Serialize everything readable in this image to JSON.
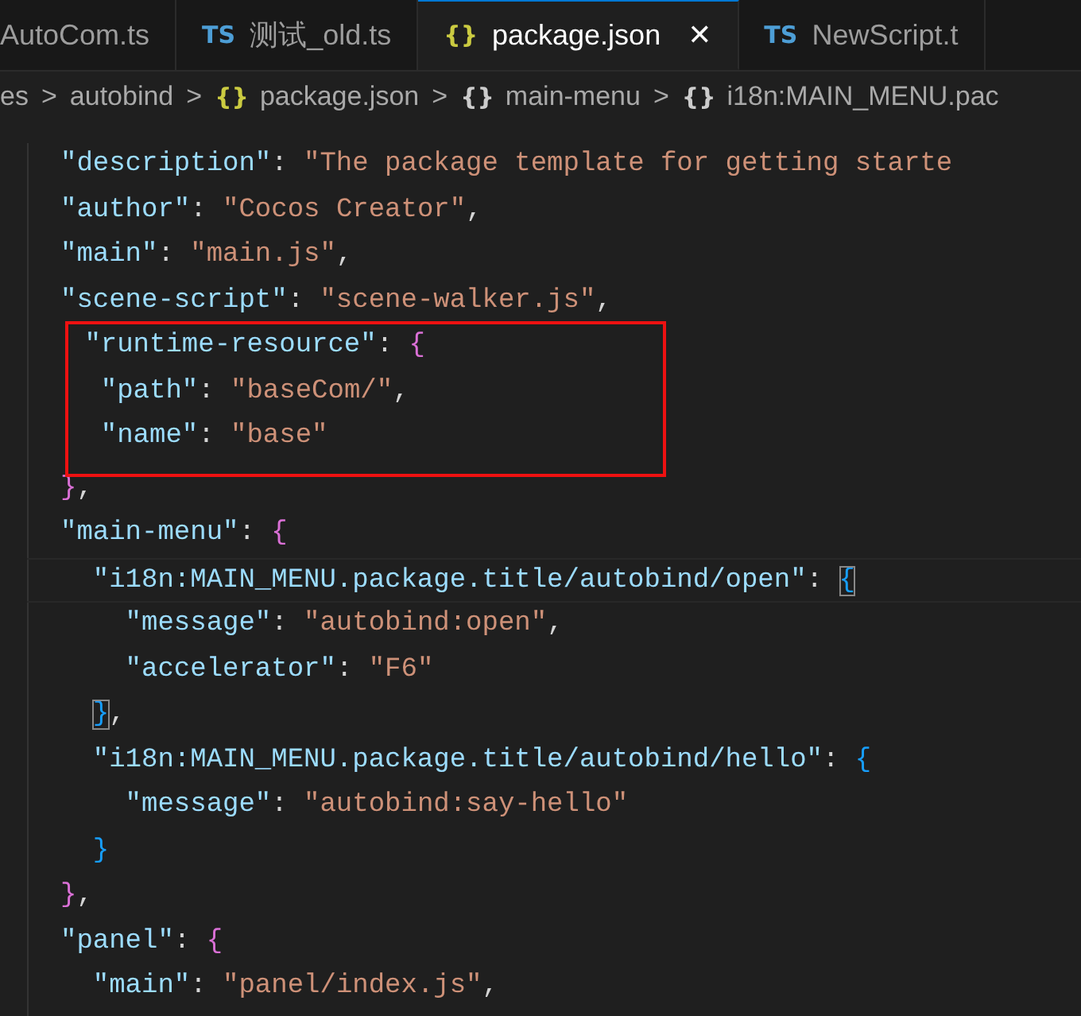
{
  "tabs": [
    {
      "label": "AutoCom.ts",
      "selected": false,
      "kind": "plain"
    },
    {
      "icon": "TS",
      "label": "测试_old.ts",
      "selected": false,
      "kind": "ts"
    },
    {
      "icon": "{}",
      "label": "package.json",
      "selected": true,
      "kind": "json",
      "close": "✕"
    },
    {
      "icon": "TS",
      "label": "NewScript.t",
      "selected": false,
      "kind": "ts"
    }
  ],
  "breadcrumbs": [
    {
      "label": "es",
      "kind": "plain"
    },
    {
      "label": "autobind",
      "kind": "plain"
    },
    {
      "icon": "{}",
      "label": "package.json",
      "kind": "json"
    },
    {
      "icon": "{}",
      "label": "main-menu",
      "kind": "symbol"
    },
    {
      "icon": "{}",
      "label": "i18n:MAIN_MENU.pac",
      "kind": "symbol"
    }
  ],
  "breadcrumb_separator": ">",
  "lines": [
    {
      "in_box": false,
      "current": false,
      "tokens": [
        {
          "kind": "key",
          "text": "\"description\""
        },
        {
          "kind": "punct",
          "text": ": "
        },
        {
          "kind": "string",
          "text": "\"The package template for getting starte"
        }
      ]
    },
    {
      "in_box": false,
      "current": false,
      "tokens": [
        {
          "kind": "key",
          "text": "\"author\""
        },
        {
          "kind": "punct",
          "text": ": "
        },
        {
          "kind": "string",
          "text": "\"Cocos Creator\""
        },
        {
          "kind": "punct",
          "text": ","
        }
      ]
    },
    {
      "in_box": false,
      "current": false,
      "tokens": [
        {
          "kind": "key",
          "text": "\"main\""
        },
        {
          "kind": "punct",
          "text": ": "
        },
        {
          "kind": "string",
          "text": "\"main.js\""
        },
        {
          "kind": "punct",
          "text": ","
        }
      ]
    },
    {
      "in_box": false,
      "current": false,
      "tokens": [
        {
          "kind": "key",
          "text": "\"scene-script\""
        },
        {
          "kind": "punct",
          "text": ": "
        },
        {
          "kind": "string",
          "text": "\"scene-walker.js\""
        },
        {
          "kind": "punct",
          "text": ","
        }
      ]
    },
    {
      "in_box": true,
      "current": false,
      "tokens": [
        {
          "kind": "key",
          "text": " \"runtime-resource\""
        },
        {
          "kind": "punct",
          "text": ": "
        },
        {
          "kind": "brace1",
          "text": "{"
        }
      ]
    },
    {
      "in_box": true,
      "current": false,
      "tokens": [
        {
          "kind": "key",
          "text": "  \"path\""
        },
        {
          "kind": "punct",
          "text": ": "
        },
        {
          "kind": "string",
          "text": "\"baseCom/\""
        },
        {
          "kind": "punct",
          "text": ","
        }
      ]
    },
    {
      "in_box": true,
      "current": false,
      "tokens": [
        {
          "kind": "key",
          "text": "  \"name\""
        },
        {
          "kind": "punct",
          "text": ": "
        },
        {
          "kind": "string",
          "text": "\"base\""
        }
      ]
    },
    {
      "in_box": false,
      "current": false,
      "tokens": [
        {
          "kind": "brace1",
          "text": "}"
        },
        {
          "kind": "punct",
          "text": ","
        }
      ]
    },
    {
      "in_box": false,
      "current": false,
      "tokens": [
        {
          "kind": "key",
          "text": "\"main-menu\""
        },
        {
          "kind": "punct",
          "text": ": "
        },
        {
          "kind": "brace1",
          "text": "{"
        }
      ]
    },
    {
      "in_box": false,
      "current": true,
      "tokens": [
        {
          "kind": "key",
          "text": "  \"i18n:MAIN_MENU.package.title/autobind/open\""
        },
        {
          "kind": "punct",
          "text": ": "
        },
        {
          "kind": "brace2_match",
          "text": "{"
        }
      ]
    },
    {
      "in_box": false,
      "current": false,
      "tokens": [
        {
          "kind": "key",
          "text": "    \"message\""
        },
        {
          "kind": "punct",
          "text": ": "
        },
        {
          "kind": "string",
          "text": "\"autobind:open\""
        },
        {
          "kind": "punct",
          "text": ","
        }
      ]
    },
    {
      "in_box": false,
      "current": false,
      "tokens": [
        {
          "kind": "key",
          "text": "    \"accelerator\""
        },
        {
          "kind": "punct",
          "text": ": "
        },
        {
          "kind": "string",
          "text": "\"F6\""
        }
      ]
    },
    {
      "in_box": false,
      "current": false,
      "tokens": [
        {
          "kind": "brace2_match",
          "text": "}"
        },
        {
          "kind": "punct",
          "text": ","
        }
      ],
      "nested": true
    },
    {
      "in_box": false,
      "current": false,
      "tokens": [
        {
          "kind": "key",
          "text": "  \"i18n:MAIN_MENU.package.title/autobind/hello\""
        },
        {
          "kind": "punct",
          "text": ": "
        },
        {
          "kind": "brace2",
          "text": "{"
        }
      ]
    },
    {
      "in_box": false,
      "current": false,
      "tokens": [
        {
          "kind": "key",
          "text": "    \"message\""
        },
        {
          "kind": "punct",
          "text": ": "
        },
        {
          "kind": "string",
          "text": "\"autobind:say-hello\""
        }
      ]
    },
    {
      "in_box": false,
      "current": false,
      "tokens": [
        {
          "kind": "brace2",
          "text": "}"
        }
      ],
      "nested": true
    },
    {
      "in_box": false,
      "current": false,
      "tokens": [
        {
          "kind": "brace1",
          "text": "}"
        },
        {
          "kind": "punct",
          "text": ","
        }
      ]
    },
    {
      "in_box": false,
      "current": false,
      "tokens": [
        {
          "kind": "key",
          "text": "\"panel\""
        },
        {
          "kind": "punct",
          "text": ": "
        },
        {
          "kind": "brace1",
          "text": "{"
        }
      ]
    },
    {
      "in_box": false,
      "current": false,
      "tokens": [
        {
          "kind": "key",
          "text": "  \"main\""
        },
        {
          "kind": "punct",
          "text": ": "
        },
        {
          "kind": "string",
          "text": "\"panel/index.js\""
        },
        {
          "kind": "punct",
          "text": ","
        }
      ]
    }
  ]
}
